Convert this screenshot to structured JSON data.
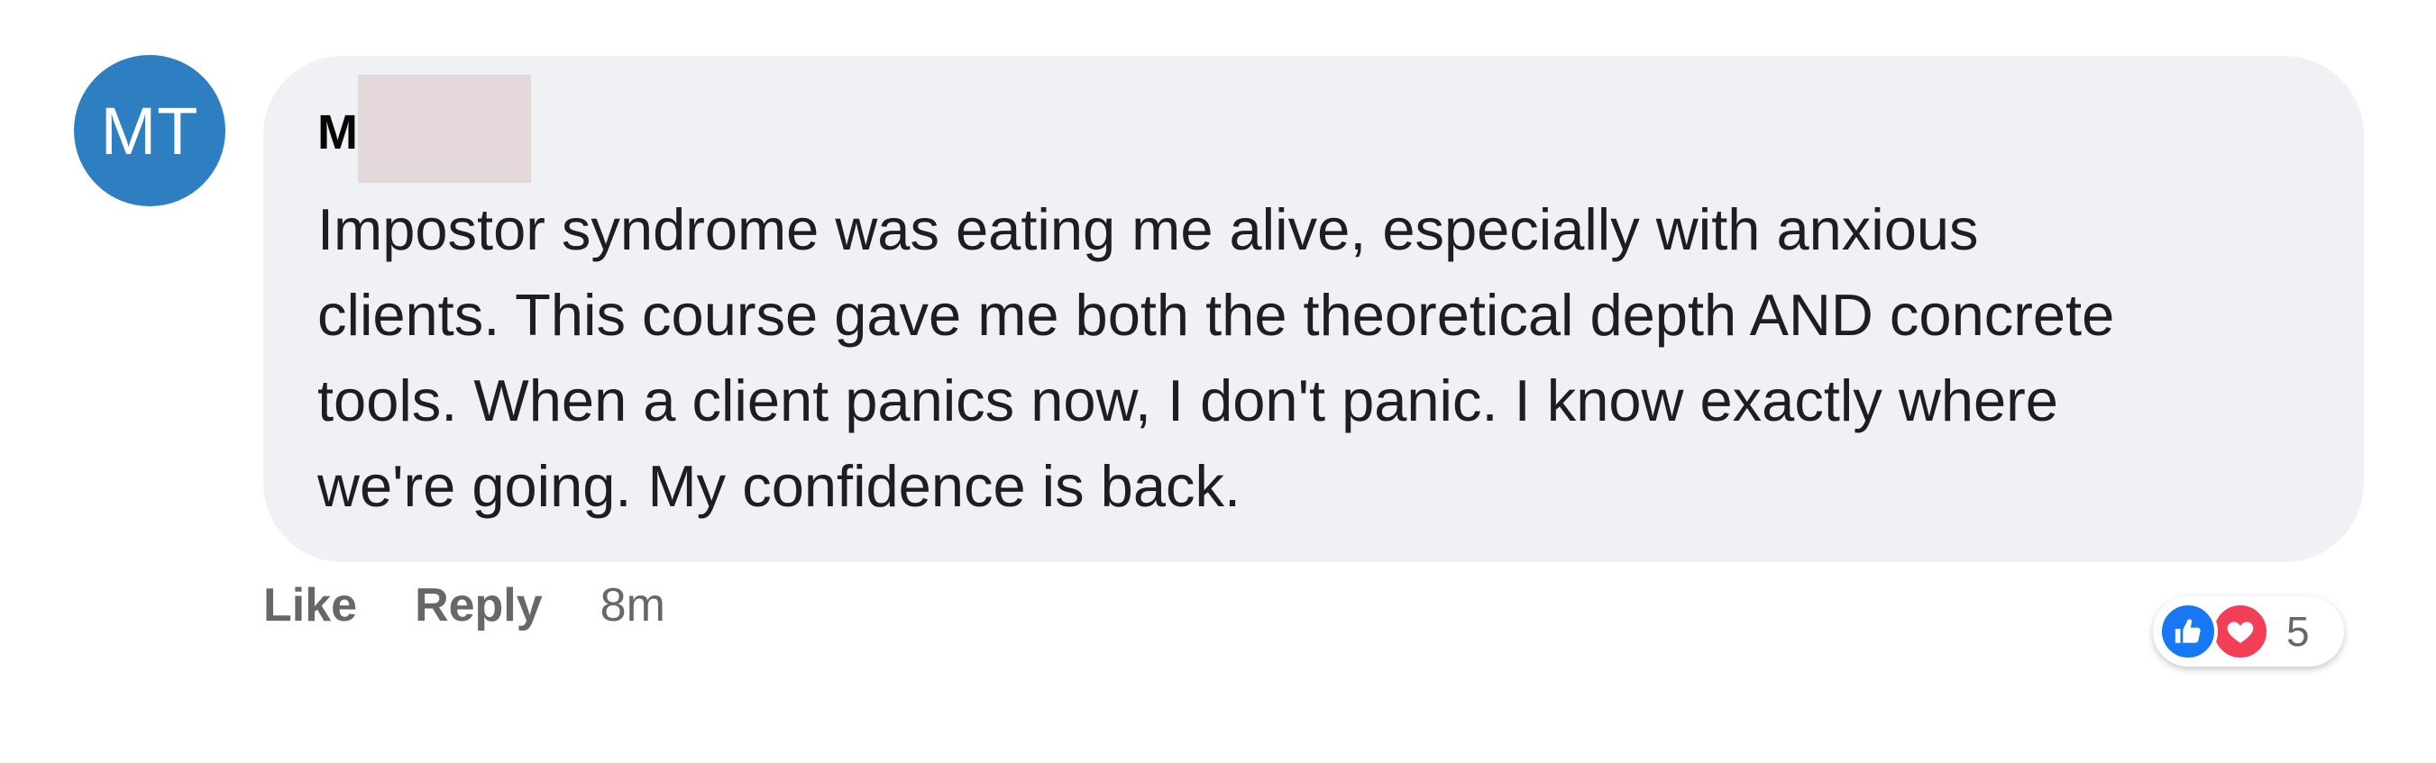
{
  "comment": {
    "avatar_initials": "MT",
    "author_visible_initial": "M",
    "text": "Impostor syndrome was eating me alive, especially with anxious\nclients. This course gave me both the theoretical depth AND concrete\ntools. When a client panics now, I don't panic. I know exactly where\nwe're going. My confidence is back.",
    "actions": {
      "like_label": "Like",
      "reply_label": "Reply",
      "timestamp": "8m"
    },
    "reactions": {
      "icons": [
        "thumbs-up-icon",
        "heart-icon"
      ],
      "count": "5"
    }
  },
  "colors": {
    "avatar_bg": "#2e7fc1",
    "bubble_bg": "#f0f1f5",
    "like_blue": "#1877f2",
    "love_red": "#f33e58",
    "secondary_text": "#65676b"
  }
}
